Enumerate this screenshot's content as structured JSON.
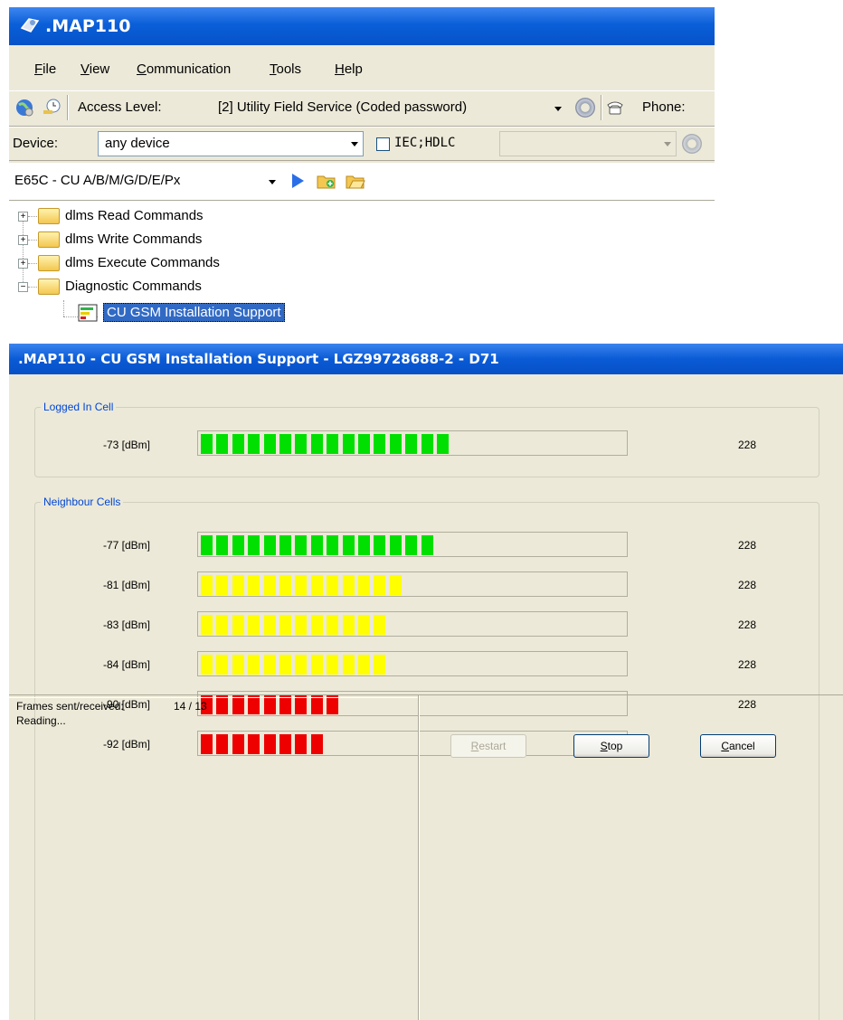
{
  "app": {
    "title": ".MAP110",
    "menu": [
      "File",
      "View",
      "Communication",
      "Tools",
      "Help"
    ],
    "toolbar1": {
      "access_label": "Access Level:",
      "access_value": "[2] Utility Field Service (Coded password)",
      "phone_label": "Phone:"
    },
    "toolbar2": {
      "device_label": "Device:",
      "device_value": "any device",
      "protocol_label": "IEC;HDLC",
      "protocol_value": ""
    },
    "toolbar3": {
      "meter_value": "E65C - CU A/B/M/G/D/E/Px"
    },
    "tree": [
      {
        "label": "dlms Read Commands",
        "expanded": false
      },
      {
        "label": "dlms Write Commands",
        "expanded": false
      },
      {
        "label": "dlms Execute Commands",
        "expanded": false
      },
      {
        "label": "Diagnostic Commands",
        "expanded": true
      },
      {
        "label": "CU GSM Installation Support",
        "selected": true
      }
    ]
  },
  "dialog": {
    "title": ".MAP110 - CU GSM Installation Support - LGZ99728688-2 - D71",
    "logged_group": "Logged In Cell",
    "neighbour_group": "Neighbour Cells",
    "logged_cell": {
      "label": "-73 [dBm]",
      "segments": 16,
      "color": "#00e000",
      "value": "228"
    },
    "neighbours": [
      {
        "label": "-77 [dBm]",
        "segments": 15,
        "color": "#00e000",
        "value": "228"
      },
      {
        "label": "-81 [dBm]",
        "segments": 13,
        "color": "#ffff00",
        "value": "228"
      },
      {
        "label": "-83 [dBm]",
        "segments": 12,
        "color": "#ffff00",
        "value": "228"
      },
      {
        "label": "-84 [dBm]",
        "segments": 12,
        "color": "#ffff00",
        "value": "228"
      },
      {
        "label": "-90 [dBm]",
        "segments": 9,
        "color": "#ee0000",
        "value": "228"
      },
      {
        "label": "-92 [dBm]",
        "segments": 8,
        "color": "#ee0000",
        "value": "228"
      }
    ],
    "status": {
      "frames_label": "Frames sent/received:",
      "frames_value": "14 / 13",
      "state": "Reading..."
    },
    "buttons": {
      "restart": "Restart",
      "stop": "Stop",
      "cancel": "Cancel"
    }
  }
}
